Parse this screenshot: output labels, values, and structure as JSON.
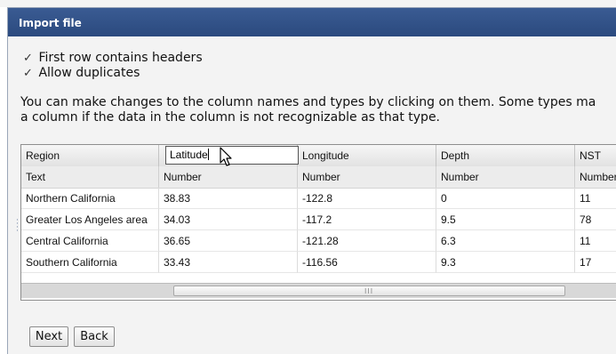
{
  "dialog": {
    "title": "Import file",
    "options": [
      {
        "label": "First row contains headers",
        "checked": true
      },
      {
        "label": "Allow duplicates",
        "checked": true
      }
    ],
    "description_line1": "You can make changes to the column names and types by clicking on them. Some types ma",
    "description_line2": "a column if the data in the column is not recognizable as that type.",
    "buttons": {
      "next": "Next",
      "back": "Back"
    }
  },
  "grid": {
    "headers": [
      "Region",
      "Latitude",
      "Longitude",
      "Depth",
      "NST"
    ],
    "editing_value": "Latitude",
    "types": [
      "Text",
      "Number",
      "Number",
      "Number",
      "Number"
    ],
    "rows": [
      [
        "Northern California",
        "38.83",
        "-122.8",
        "0",
        "11"
      ],
      [
        "Greater Los Angeles area",
        "34.03",
        "-117.2",
        "9.5",
        "78"
      ],
      [
        "Central California",
        "36.65",
        "-121.28",
        "6.3",
        "11"
      ],
      [
        "Southern California",
        "33.43",
        "-116.56",
        "9.3",
        "17"
      ]
    ]
  },
  "icons": {
    "checkbox": "checkmark-icon",
    "cursor": "mouse-pointer-icon",
    "scroll_grip": "grip-icon"
  }
}
